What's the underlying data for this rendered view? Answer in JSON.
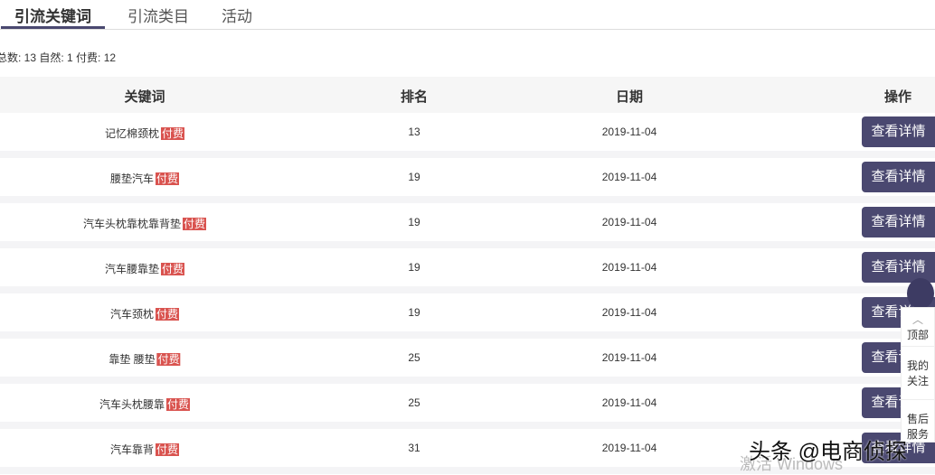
{
  "tabs": [
    {
      "label": "引流关键词"
    },
    {
      "label": "引流类目"
    },
    {
      "label": "活动"
    }
  ],
  "summary": "总数: 13 自然: 1 付费: 12",
  "columns": {
    "keyword": "关键词",
    "rank": "排名",
    "date": "日期",
    "action": "操作"
  },
  "rows": [
    {
      "keyword": "记忆棉颈枕",
      "tag": "付费",
      "rank": "13",
      "date": "2019-11-04",
      "button": "查看详情"
    },
    {
      "keyword": "腰垫汽车",
      "tag": "付费",
      "rank": "19",
      "date": "2019-11-04",
      "button": "查看详情"
    },
    {
      "keyword": "汽车头枕靠枕靠背垫",
      "tag": "付费",
      "rank": "19",
      "date": "2019-11-04",
      "button": "查看详情"
    },
    {
      "keyword": "汽车腰靠垫",
      "tag": "付费",
      "rank": "19",
      "date": "2019-11-04",
      "button": "查看详情"
    },
    {
      "keyword": "汽车颈枕",
      "tag": "付费",
      "rank": "19",
      "date": "2019-11-04",
      "button": "查看详情"
    },
    {
      "keyword": "靠垫 腰垫",
      "tag": "付费",
      "rank": "25",
      "date": "2019-11-04",
      "button": "查看详情"
    },
    {
      "keyword": "汽车头枕腰靠",
      "tag": "付费",
      "rank": "25",
      "date": "2019-11-04",
      "button": "查看详情"
    },
    {
      "keyword": "汽车靠背",
      "tag": "付费",
      "rank": "31",
      "date": "2019-11-04",
      "button": "查看详情"
    }
  ],
  "float_menu": {
    "top": "顶部",
    "follow": "我的关注",
    "service": "售后服务",
    "up_icon": "chevron-up-icon"
  },
  "watermark": "头条 @电商侦探",
  "activate": "激活 Windows"
}
